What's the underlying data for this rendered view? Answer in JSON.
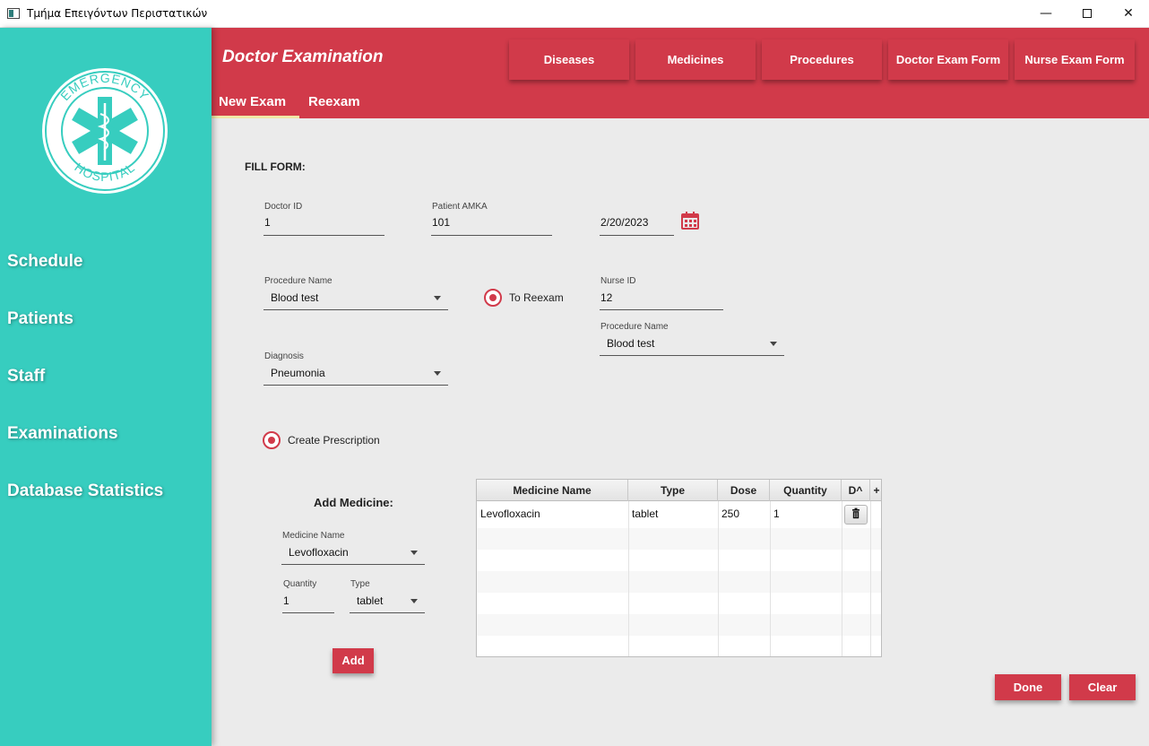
{
  "window": {
    "title": "Τμήμα Επειγόντων Περιστατικών",
    "minimize": "—",
    "close": "✕"
  },
  "sidebar": {
    "logo_text": "EMERGENCY HOSPITAL",
    "items": [
      {
        "label": "Schedule"
      },
      {
        "label": "Patients"
      },
      {
        "label": "Staff"
      },
      {
        "label": "Examinations"
      },
      {
        "label": "Database Statistics"
      }
    ]
  },
  "header": {
    "title": "Doctor Examination",
    "buttons": [
      {
        "label": "Diseases"
      },
      {
        "label": "Medicines"
      },
      {
        "label": "Procedures"
      },
      {
        "label": "Doctor Exam Form"
      },
      {
        "label": "Nurse Exam Form"
      }
    ],
    "tabs": [
      {
        "label": "New Exam",
        "active": true
      },
      {
        "label": "Reexam",
        "active": false
      }
    ]
  },
  "form": {
    "heading": "FILL FORM:",
    "doctor_id": {
      "label": "Doctor ID",
      "value": "1"
    },
    "patient_amka": {
      "label": "Patient AMKA",
      "value": "101"
    },
    "date": {
      "value": "2/20/2023"
    },
    "procedure": {
      "label": "Procedure Name",
      "value": "Blood test"
    },
    "to_reexam": {
      "label": "To Reexam",
      "selected": true
    },
    "nurse_id": {
      "label": "Nurse ID",
      "value": "12"
    },
    "nurse_procedure": {
      "label": "Procedure Name",
      "value": "Blood test"
    },
    "diagnosis": {
      "label": "Diagnosis",
      "value": "Pneumonia"
    },
    "create_prescription": {
      "label": "Create Prescription",
      "selected": true
    }
  },
  "add_medicine": {
    "heading": "Add Medicine:",
    "medicine_name": {
      "label": "Medicine Name",
      "value": "Levofloxacin"
    },
    "quantity": {
      "label": "Quantity",
      "value": "1"
    },
    "type": {
      "label": "Type",
      "value": "tablet"
    },
    "add_label": "Add"
  },
  "table": {
    "columns": [
      "Medicine Name",
      "Type",
      "Dose",
      "Quantity",
      "D^",
      "+"
    ],
    "rows": [
      {
        "medicine": "Levofloxacin",
        "type": "tablet",
        "dose": "250",
        "quantity": "1"
      }
    ]
  },
  "actions": {
    "done": "Done",
    "clear": "Clear"
  },
  "colors": {
    "sidebar": "#37cdbf",
    "header": "#d13a4a",
    "accent_red": "#d13a4a",
    "background": "#ebebeb"
  }
}
